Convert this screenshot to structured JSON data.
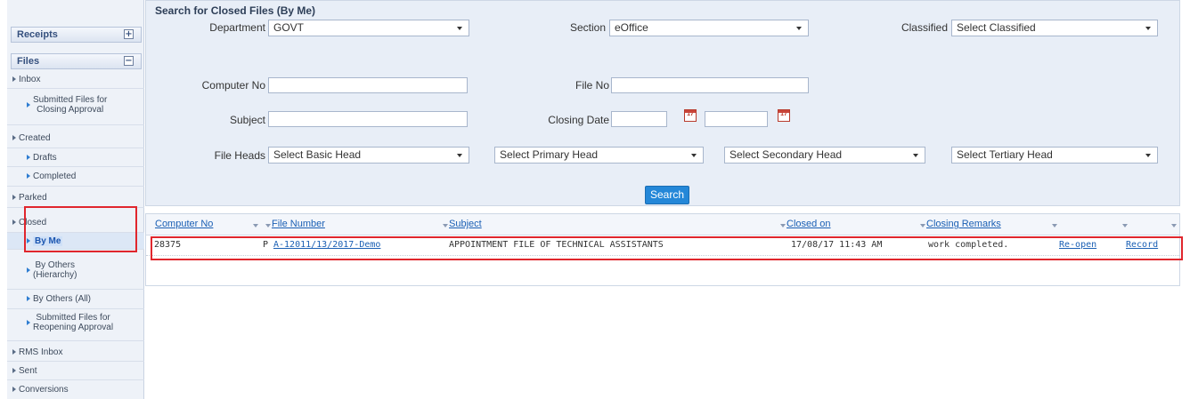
{
  "sidebar": {
    "receipts": {
      "label": "Receipts",
      "toggle": "+"
    },
    "files": {
      "label": "Files",
      "toggle": "−"
    },
    "items": {
      "inbox": "Inbox",
      "submitted_closing_1": "Submitted Files for",
      "submitted_closing_2": "Closing Approval",
      "created": "Created",
      "drafts": "Drafts",
      "completed": "Completed",
      "parked": "Parked",
      "closed": "Closed",
      "by_me": "By Me",
      "by_others_1": "By Others",
      "by_others_2": "(Hierarchy)",
      "by_others_all": "By Others (All)",
      "submitted_reopening_1": "Submitted Files for",
      "submitted_reopening_2": "Reopening Approval",
      "rms_inbox": "RMS Inbox",
      "sent": "Sent",
      "conversions": "Conversions"
    }
  },
  "search": {
    "title": "Search for Closed Files (By Me)",
    "department": {
      "label": "Department",
      "value": "GOVT"
    },
    "section": {
      "label": "Section",
      "value": "eOffice"
    },
    "classified": {
      "label": "Classified",
      "value": "Select Classified"
    },
    "computer_no": {
      "label": "Computer No",
      "value": ""
    },
    "file_no": {
      "label": "File No",
      "value": ""
    },
    "subject": {
      "label": "Subject",
      "value": ""
    },
    "closing_date": {
      "label": "Closing Date",
      "from": "",
      "to": "",
      "cal_text": "17"
    },
    "file_heads": {
      "label": "File Heads",
      "basic": "Select Basic Head",
      "primary": "Select Primary Head",
      "secondary": "Select Secondary Head",
      "tertiary": "Select Tertiary Head"
    },
    "button": "Search"
  },
  "table": {
    "columns": {
      "computer_no": "Computer No",
      "file_number": "File Number",
      "subject": "Subject",
      "closed_on": "Closed on",
      "closing_remarks": "Closing Remarks"
    },
    "rows": [
      {
        "computer_no": "28375",
        "type": "P",
        "file_number": "A-12011/13/2017-Demo",
        "subject": "APPOINTMENT FILE OF TECHNICAL ASSISTANTS",
        "closed_on": "17/08/17 11:43 AM",
        "closing_remarks": "work completed.",
        "reopen": "Re-open",
        "record": "Record"
      }
    ]
  },
  "colors": {
    "highlight_box": "#e0262d",
    "link": "#1a5fb4",
    "button": "#2487d8"
  }
}
